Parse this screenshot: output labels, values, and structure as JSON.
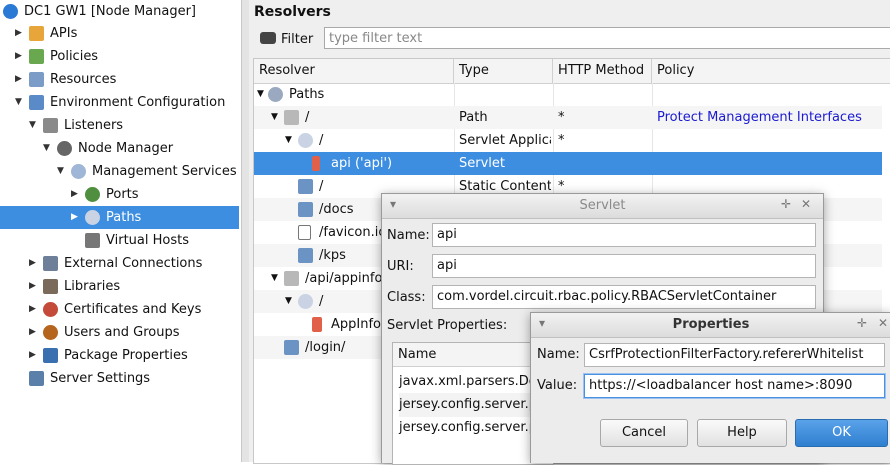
{
  "tree": {
    "items": [
      {
        "label": "DC1 GW1 [Node Manager]",
        "arrow": "",
        "icon_color": "#2a7ad5"
      },
      {
        "label": "APIs",
        "arrow": "▶",
        "icon_color": "#e8a53a"
      },
      {
        "label": "Policies",
        "arrow": "▶",
        "icon_color": "#6aa84f"
      },
      {
        "label": "Resources",
        "arrow": "▶",
        "icon_color": "#7a9cc6"
      },
      {
        "label": "Environment Configuration",
        "arrow": "▼",
        "icon_color": "#5b8ac9"
      },
      {
        "label": "Listeners",
        "arrow": "▼",
        "icon_color": "#8a8a8a"
      },
      {
        "label": "Node Manager",
        "arrow": "▼",
        "icon_color": "#666666"
      },
      {
        "label": "Management Services",
        "arrow": "▼",
        "icon_color": "#9fb6d6"
      },
      {
        "label": "Ports",
        "arrow": "▶",
        "icon_color": "#4f8f3f"
      },
      {
        "label": "Paths",
        "arrow": "▶",
        "icon_color": "#9aa9c0"
      },
      {
        "label": "Virtual Hosts",
        "arrow": "",
        "icon_color": "#777777"
      },
      {
        "label": "External Connections",
        "arrow": "▶",
        "icon_color": "#6e7f9a"
      },
      {
        "label": "Libraries",
        "arrow": "▶",
        "icon_color": "#7a6a5a"
      },
      {
        "label": "Certificates and Keys",
        "arrow": "▶",
        "icon_color": "#c44b3a"
      },
      {
        "label": "Users and Groups",
        "arrow": "▶",
        "icon_color": "#b5651d"
      },
      {
        "label": "Package Properties",
        "arrow": "▶",
        "icon_color": "#3a6fb0"
      },
      {
        "label": "Server Settings",
        "arrow": "",
        "icon_color": "#5a7fa8"
      }
    ]
  },
  "resolvers": {
    "title": "Resolvers",
    "filter_label": "Filter",
    "filter_placeholder": "type filter text",
    "columns": [
      "Resolver",
      "Type",
      "HTTP Method",
      "Policy"
    ],
    "rows": [
      {
        "resolver": "Paths",
        "arrow": "▼",
        "type": "",
        "method": "",
        "policy": ""
      },
      {
        "resolver": "/",
        "arrow": "▼",
        "type": "Path",
        "method": "*",
        "policy": "Protect Management Interfaces"
      },
      {
        "resolver": "/",
        "arrow": "▼",
        "type": "Servlet Applicat",
        "method": "*",
        "policy": ""
      },
      {
        "resolver": "api ('api')",
        "arrow": "",
        "type": "Servlet",
        "method": "",
        "policy": ""
      },
      {
        "resolver": "/",
        "arrow": "",
        "type": "Static Content",
        "method": "*",
        "policy": ""
      },
      {
        "resolver": "/docs",
        "arrow": "",
        "type": "",
        "method": "",
        "policy": ""
      },
      {
        "resolver": "/favicon.ico",
        "arrow": "",
        "type": "",
        "method": "",
        "policy": ""
      },
      {
        "resolver": "/kps",
        "arrow": "",
        "type": "",
        "method": "",
        "policy": ""
      },
      {
        "resolver": "/api/appinfo",
        "arrow": "▼",
        "type": "",
        "method": "",
        "policy": ""
      },
      {
        "resolver": "/",
        "arrow": "▼",
        "type": "",
        "method": "",
        "policy": ""
      },
      {
        "resolver": "AppInfo",
        "arrow": "",
        "type": "",
        "method": "",
        "policy": ""
      },
      {
        "resolver": "/login/",
        "arrow": "",
        "type": "",
        "method": "",
        "policy": ""
      }
    ]
  },
  "servlet_dialog": {
    "title": "Servlet",
    "name_label": "Name:",
    "name_value": "api",
    "uri_label": "URI:",
    "uri_value": "api",
    "class_label": "Class:",
    "class_value": "com.vordel.circuit.rbac.policy.RBACServletContainer",
    "props_label": "Servlet Properties:",
    "props_column": "Name",
    "props_rows": [
      "javax.xml.parsers.Docu",
      "jersey.config.server.pr",
      "jersey.config.server.pr"
    ]
  },
  "properties_dialog": {
    "title": "Properties",
    "name_label": "Name:",
    "name_value": "CsrfProtectionFilterFactory.refererWhitelist",
    "value_label": "Value:",
    "value_value": "https://<loadbalancer host name>:8090",
    "cancel_label": "Cancel",
    "help_label": "Help",
    "ok_label": "OK"
  }
}
